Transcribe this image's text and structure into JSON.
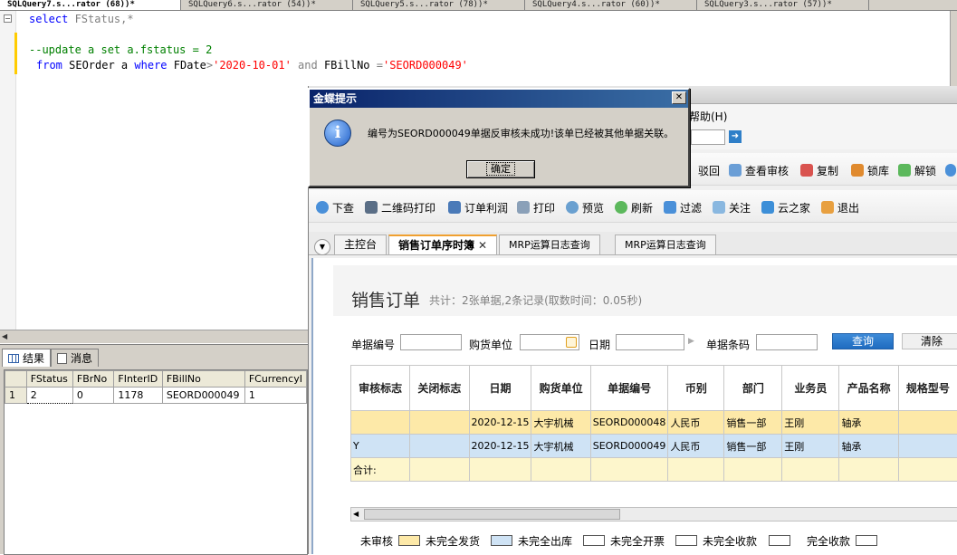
{
  "ssms": {
    "tabs": [
      "SQLQuery7.s...rator (68))*",
      "SQLQuery6.s...rator (54))*",
      "SQLQuery5.s...rator (78))*",
      "SQLQuery4.s...rator (60))*",
      "SQLQuery3.s...rator (57))*"
    ],
    "code": {
      "l1_kw": "select",
      "l1_rest": " FStatus,*",
      "l2": "--update a set a.fstatus = 2",
      "l3_from": "from",
      "l3_table": " SEOrder a ",
      "l3_where": "where",
      "l3_col1": " FDate",
      "l3_op1": ">",
      "l3_val1": "'2020-10-01'",
      "l3_and": " and",
      "l3_col2": " FBillNo ",
      "l3_op2": "=",
      "l3_val2": "'SEORD000049'"
    },
    "results_tab": "结果",
    "messages_tab": "消息",
    "grid": {
      "columns": [
        "FStatus",
        "FBrNo",
        "FInterID",
        "FBillNo",
        "FCurrencyI"
      ],
      "rows": [
        {
          "num": "1",
          "cells": [
            "2",
            "0",
            "1178",
            "SEORD000049",
            "1"
          ]
        }
      ]
    }
  },
  "k3": {
    "menu_help": "帮助(H)",
    "toolbar1": [
      "驳回",
      "查看审核",
      "复制",
      "锁库",
      "解锁"
    ],
    "toolbar2": [
      "下查",
      "二维码打印",
      "订单利润",
      "打印",
      "预览",
      "刷新",
      "过滤",
      "关注",
      "云之家",
      "退出"
    ],
    "tabs": [
      "主控台",
      "销售订单序时簿",
      "MRP运算日志查询",
      "MRP运算日志查询"
    ],
    "page_title": "销售订单",
    "page_sub": "共计：2张单据,2条记录(取数时间：0.05秒)",
    "filters": {
      "bill_no": "单据编号",
      "buyer": "购货单位",
      "date": "日期",
      "barcode": "单据条码",
      "query_btn": "查询",
      "clear_btn": "清除"
    },
    "grid": {
      "columns": [
        "审核标志",
        "关闭标志",
        "日期",
        "购货单位",
        "单据编号",
        "币别",
        "部门",
        "业务员",
        "产品名称",
        "规格型号"
      ],
      "rows": [
        [
          "",
          "",
          "2020-12-15",
          "大宇机械",
          "SEORD000048",
          "人民币",
          "销售一部",
          "王刚",
          "轴承",
          ""
        ],
        [
          "Y",
          "",
          "2020-12-15",
          "大宇机械",
          "SEORD000049",
          "人民币",
          "销售一部",
          "王刚",
          "轴承",
          ""
        ]
      ],
      "total_label": "合计:"
    },
    "legend": {
      "unaudited": "未审核",
      "not_shipped": "未完全发货",
      "not_outbound": "未完全出库",
      "not_invoiced": "未完全开票",
      "not_collected": "未完全收款",
      "fully_collected": "完全收款",
      "colors": {
        "not_shipped": "#fde9a8",
        "not_outbound": "#cfe3f5"
      }
    }
  },
  "dialog": {
    "title": "金蝶提示",
    "message": "编号为SEORD000049单据反审核未成功!该单已经被其他单据关联。",
    "ok_label": "确定",
    "close_glyph": "✕"
  }
}
